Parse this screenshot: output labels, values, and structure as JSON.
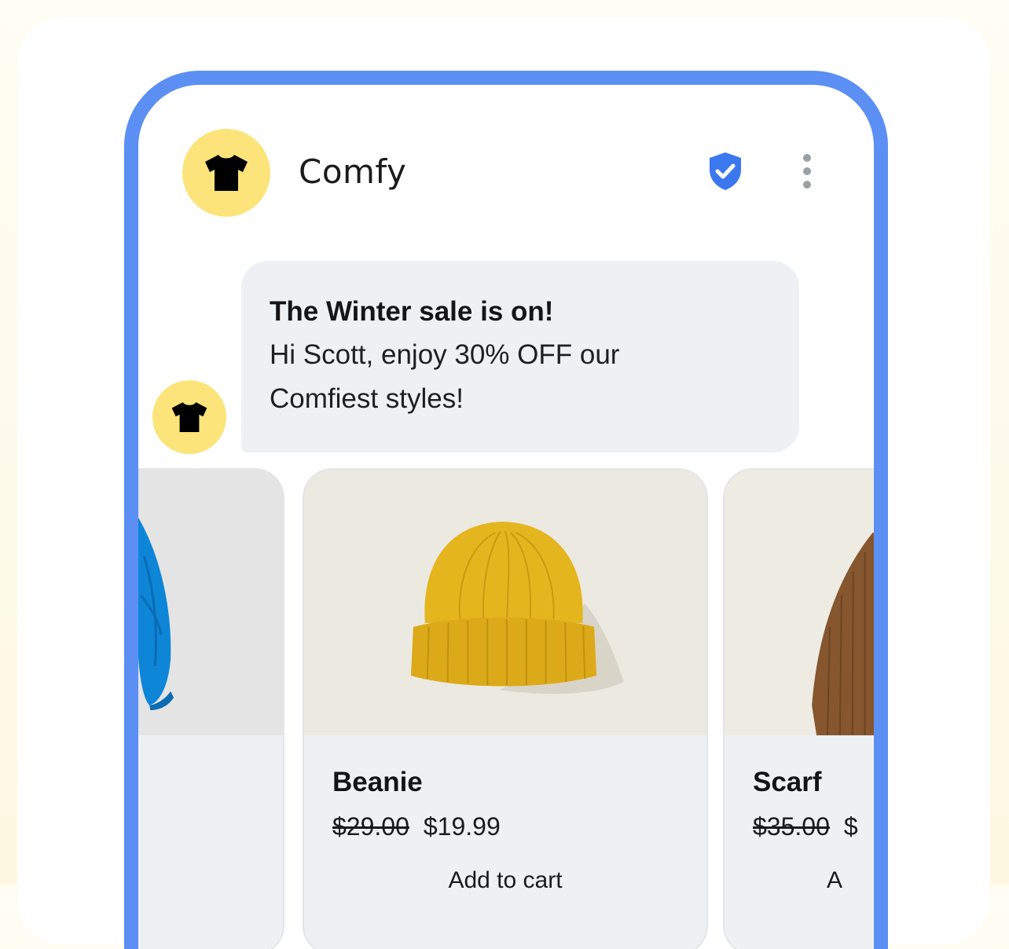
{
  "brand": {
    "name": "Comfy",
    "avatar_icon": "tshirt-icon",
    "accent_color": "#5b8ff3",
    "avatar_color": "#fde47a"
  },
  "header": {
    "verified_icon": "verified-shield-icon",
    "more_icon": "more-vertical-icon"
  },
  "message": {
    "title": "The Winter sale is on!",
    "body_line1": "Hi Scott, enjoy 30% OFF our",
    "body_line2": "Comfiest styles!"
  },
  "products": [
    {
      "name": "Beanie",
      "old_price": "$29.00",
      "price": "$19.99",
      "action_label": "Add to cart",
      "image": "yellow-beanie"
    },
    {
      "name": "Scarf",
      "old_price": "$35.00",
      "price": "$",
      "action_label": "A",
      "image": "brown-scarf"
    }
  ]
}
